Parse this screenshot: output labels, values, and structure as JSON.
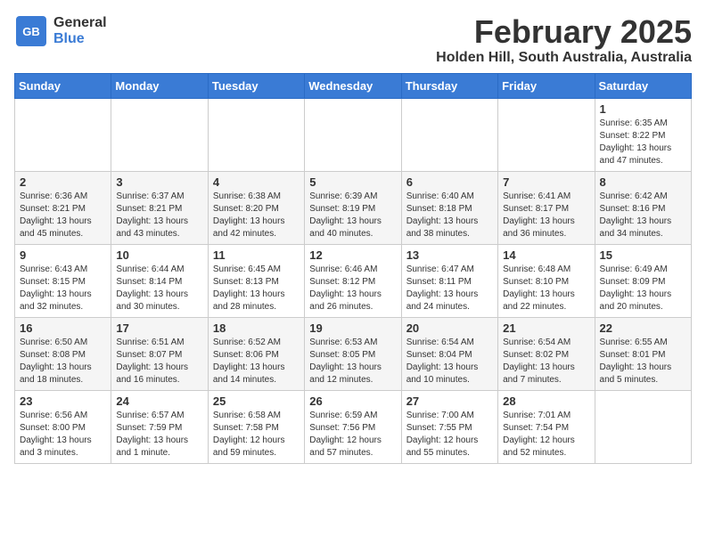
{
  "logo": {
    "general": "General",
    "blue": "Blue"
  },
  "title": "February 2025",
  "location": "Holden Hill, South Australia, Australia",
  "weekdays": [
    "Sunday",
    "Monday",
    "Tuesday",
    "Wednesday",
    "Thursday",
    "Friday",
    "Saturday"
  ],
  "weeks": [
    [
      {
        "day": "",
        "info": ""
      },
      {
        "day": "",
        "info": ""
      },
      {
        "day": "",
        "info": ""
      },
      {
        "day": "",
        "info": ""
      },
      {
        "day": "",
        "info": ""
      },
      {
        "day": "",
        "info": ""
      },
      {
        "day": "1",
        "info": "Sunrise: 6:35 AM\nSunset: 8:22 PM\nDaylight: 13 hours and 47 minutes."
      }
    ],
    [
      {
        "day": "2",
        "info": "Sunrise: 6:36 AM\nSunset: 8:21 PM\nDaylight: 13 hours and 45 minutes."
      },
      {
        "day": "3",
        "info": "Sunrise: 6:37 AM\nSunset: 8:21 PM\nDaylight: 13 hours and 43 minutes."
      },
      {
        "day": "4",
        "info": "Sunrise: 6:38 AM\nSunset: 8:20 PM\nDaylight: 13 hours and 42 minutes."
      },
      {
        "day": "5",
        "info": "Sunrise: 6:39 AM\nSunset: 8:19 PM\nDaylight: 13 hours and 40 minutes."
      },
      {
        "day": "6",
        "info": "Sunrise: 6:40 AM\nSunset: 8:18 PM\nDaylight: 13 hours and 38 minutes."
      },
      {
        "day": "7",
        "info": "Sunrise: 6:41 AM\nSunset: 8:17 PM\nDaylight: 13 hours and 36 minutes."
      },
      {
        "day": "8",
        "info": "Sunrise: 6:42 AM\nSunset: 8:16 PM\nDaylight: 13 hours and 34 minutes."
      }
    ],
    [
      {
        "day": "9",
        "info": "Sunrise: 6:43 AM\nSunset: 8:15 PM\nDaylight: 13 hours and 32 minutes."
      },
      {
        "day": "10",
        "info": "Sunrise: 6:44 AM\nSunset: 8:14 PM\nDaylight: 13 hours and 30 minutes."
      },
      {
        "day": "11",
        "info": "Sunrise: 6:45 AM\nSunset: 8:13 PM\nDaylight: 13 hours and 28 minutes."
      },
      {
        "day": "12",
        "info": "Sunrise: 6:46 AM\nSunset: 8:12 PM\nDaylight: 13 hours and 26 minutes."
      },
      {
        "day": "13",
        "info": "Sunrise: 6:47 AM\nSunset: 8:11 PM\nDaylight: 13 hours and 24 minutes."
      },
      {
        "day": "14",
        "info": "Sunrise: 6:48 AM\nSunset: 8:10 PM\nDaylight: 13 hours and 22 minutes."
      },
      {
        "day": "15",
        "info": "Sunrise: 6:49 AM\nSunset: 8:09 PM\nDaylight: 13 hours and 20 minutes."
      }
    ],
    [
      {
        "day": "16",
        "info": "Sunrise: 6:50 AM\nSunset: 8:08 PM\nDaylight: 13 hours and 18 minutes."
      },
      {
        "day": "17",
        "info": "Sunrise: 6:51 AM\nSunset: 8:07 PM\nDaylight: 13 hours and 16 minutes."
      },
      {
        "day": "18",
        "info": "Sunrise: 6:52 AM\nSunset: 8:06 PM\nDaylight: 13 hours and 14 minutes."
      },
      {
        "day": "19",
        "info": "Sunrise: 6:53 AM\nSunset: 8:05 PM\nDaylight: 13 hours and 12 minutes."
      },
      {
        "day": "20",
        "info": "Sunrise: 6:54 AM\nSunset: 8:04 PM\nDaylight: 13 hours and 10 minutes."
      },
      {
        "day": "21",
        "info": "Sunrise: 6:54 AM\nSunset: 8:02 PM\nDaylight: 13 hours and 7 minutes."
      },
      {
        "day": "22",
        "info": "Sunrise: 6:55 AM\nSunset: 8:01 PM\nDaylight: 13 hours and 5 minutes."
      }
    ],
    [
      {
        "day": "23",
        "info": "Sunrise: 6:56 AM\nSunset: 8:00 PM\nDaylight: 13 hours and 3 minutes."
      },
      {
        "day": "24",
        "info": "Sunrise: 6:57 AM\nSunset: 7:59 PM\nDaylight: 13 hours and 1 minute."
      },
      {
        "day": "25",
        "info": "Sunrise: 6:58 AM\nSunset: 7:58 PM\nDaylight: 12 hours and 59 minutes."
      },
      {
        "day": "26",
        "info": "Sunrise: 6:59 AM\nSunset: 7:56 PM\nDaylight: 12 hours and 57 minutes."
      },
      {
        "day": "27",
        "info": "Sunrise: 7:00 AM\nSunset: 7:55 PM\nDaylight: 12 hours and 55 minutes."
      },
      {
        "day": "28",
        "info": "Sunrise: 7:01 AM\nSunset: 7:54 PM\nDaylight: 12 hours and 52 minutes."
      },
      {
        "day": "",
        "info": ""
      }
    ]
  ]
}
